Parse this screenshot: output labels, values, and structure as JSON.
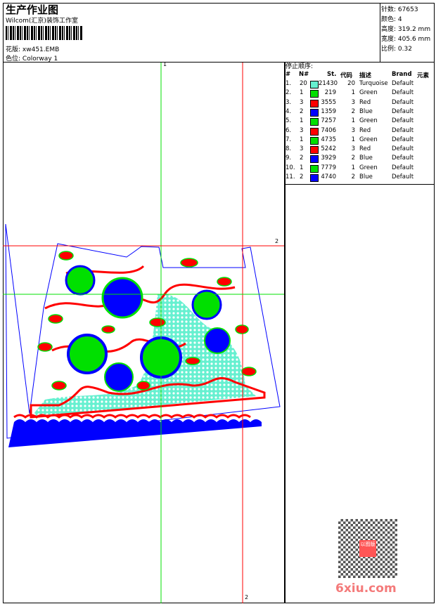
{
  "header": {
    "title": "生产作业图",
    "company": "Wilcom(汇京)装饰工作室",
    "design_label": "花版:",
    "design_value": "xw451.EMB",
    "colorway_label": "色位:",
    "colorway_value": "Colorway 1"
  },
  "info": [
    {
      "label": "针数:",
      "value": "67653"
    },
    {
      "label": "颜色:",
      "value": "4"
    },
    {
      "label": "高度:",
      "value": "319.2 mm"
    },
    {
      "label": "宽度:",
      "value": "405.6 mm"
    },
    {
      "label": "比例:",
      "value": "0.32"
    }
  ],
  "stop_sequence": {
    "title": "停止顺序:",
    "columns": [
      "#",
      "N#",
      "St.",
      "代码",
      "描述",
      "Brand",
      "元素"
    ],
    "rows": [
      {
        "num": "1.",
        "n": "20",
        "color": "#66f0d0",
        "st": "21430",
        "code": "20",
        "desc": "Turquoise",
        "brand": "Default"
      },
      {
        "num": "2.",
        "n": "1",
        "color": "#00e000",
        "st": "219",
        "code": "1",
        "desc": "Green",
        "brand": "Default"
      },
      {
        "num": "3.",
        "n": "3",
        "color": "#ff0000",
        "st": "3555",
        "code": "3",
        "desc": "Red",
        "brand": "Default"
      },
      {
        "num": "4.",
        "n": "2",
        "color": "#0000ff",
        "st": "1359",
        "code": "2",
        "desc": "Blue",
        "brand": "Default"
      },
      {
        "num": "5.",
        "n": "1",
        "color": "#00e000",
        "st": "7257",
        "code": "1",
        "desc": "Green",
        "brand": "Default"
      },
      {
        "num": "6.",
        "n": "3",
        "color": "#ff0000",
        "st": "7406",
        "code": "3",
        "desc": "Red",
        "brand": "Default"
      },
      {
        "num": "7.",
        "n": "1",
        "color": "#00e000",
        "st": "4735",
        "code": "1",
        "desc": "Green",
        "brand": "Default"
      },
      {
        "num": "8.",
        "n": "3",
        "color": "#ff0000",
        "st": "5242",
        "code": "3",
        "desc": "Red",
        "brand": "Default"
      },
      {
        "num": "9.",
        "n": "2",
        "color": "#0000ff",
        "st": "3929",
        "code": "2",
        "desc": "Blue",
        "brand": "Default"
      },
      {
        "num": "10.",
        "n": "1",
        "color": "#00e000",
        "st": "7779",
        "code": "1",
        "desc": "Green",
        "brand": "Default"
      },
      {
        "num": "11.",
        "n": "2",
        "color": "#0000ff",
        "st": "4740",
        "code": "2",
        "desc": "Blue",
        "brand": "Default"
      }
    ]
  },
  "guides": {
    "green_v": "1",
    "red_h": "2",
    "red_v": "2"
  },
  "watermark": {
    "text": "6xiu.com",
    "seal": "以图版"
  }
}
